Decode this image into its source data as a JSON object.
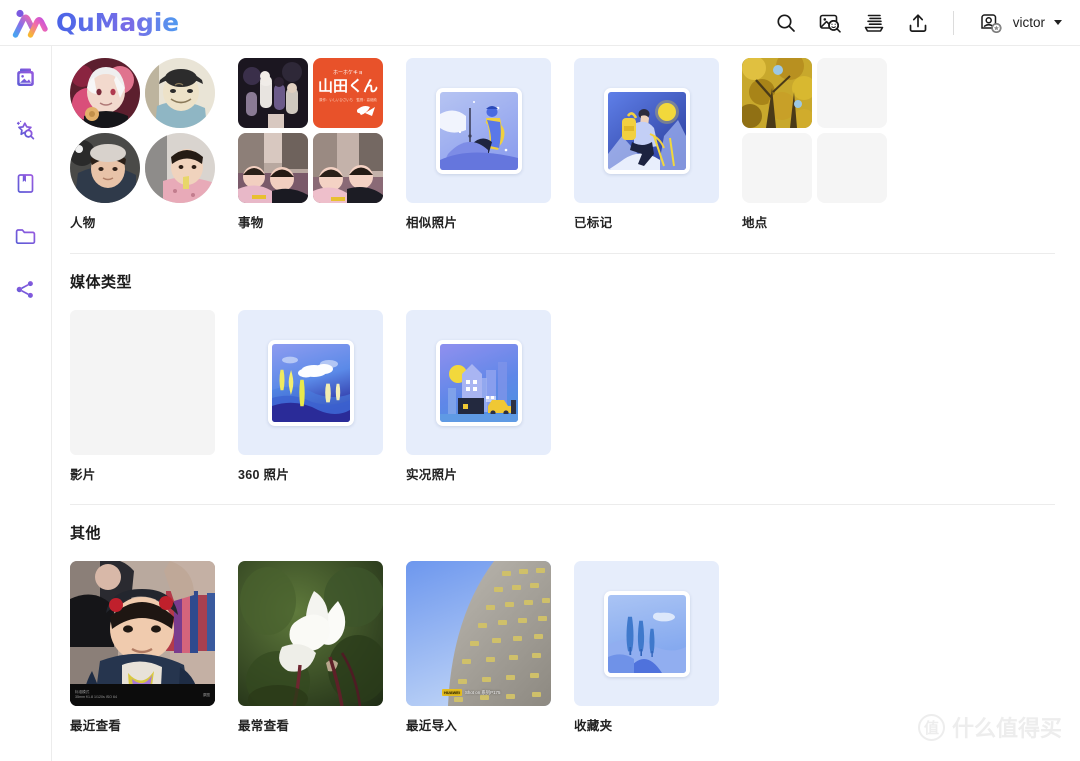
{
  "app": {
    "name": "QuMagie",
    "logo_icon": "qumagie-logo-icon"
  },
  "topbar": {
    "icons": [
      {
        "name": "search-icon",
        "label": "搜索"
      },
      {
        "name": "image-search-icon",
        "label": "以图搜图"
      },
      {
        "name": "slideshow-icon",
        "label": "幻灯片"
      },
      {
        "name": "upload-icon",
        "label": "上传"
      }
    ],
    "user": {
      "name": "victor",
      "avatar_icon": "user-avatar-icon",
      "badge_icon": "star-badge-icon",
      "caret_icon": "chevron-down-icon"
    }
  },
  "sidebar": {
    "items": [
      {
        "name": "sidebar-item-photos",
        "icon": "photos-icon",
        "active": true
      },
      {
        "name": "sidebar-item-explore",
        "icon": "magic-wand-search-icon",
        "active": false
      },
      {
        "name": "sidebar-item-albums",
        "icon": "album-book-icon",
        "active": false
      },
      {
        "name": "sidebar-item-folders",
        "icon": "folder-icon",
        "active": false
      },
      {
        "name": "sidebar-item-shared",
        "icon": "share-icon",
        "active": false
      }
    ]
  },
  "sections": [
    {
      "id": "top",
      "title": "",
      "tiles": [
        {
          "label": "人物",
          "kind": "circle-grid"
        },
        {
          "label": "事物",
          "kind": "square-grid"
        },
        {
          "label": "相似照片",
          "kind": "illustration-flag"
        },
        {
          "label": "已标记",
          "kind": "illustration-hiker"
        },
        {
          "label": "地点",
          "kind": "partial-grid"
        }
      ]
    },
    {
      "id": "media-type",
      "title": "媒体类型",
      "tiles": [
        {
          "label": "影片",
          "kind": "empty"
        },
        {
          "label": "360 照片",
          "kind": "illustration-landscape"
        },
        {
          "label": "实况照片",
          "kind": "illustration-city"
        }
      ]
    },
    {
      "id": "other",
      "title": "其他",
      "tiles": [
        {
          "label": "最近查看",
          "kind": "photo-kid"
        },
        {
          "label": "最常查看",
          "kind": "photo-flower"
        },
        {
          "label": "最近导入",
          "kind": "photo-building"
        },
        {
          "label": "收藏夹",
          "kind": "illustration-trees"
        }
      ]
    }
  ],
  "photo_overlays": {
    "exif_line1": "标准模式",
    "exif_line2": "35mm f/1.8 1/120s ISO 64",
    "exif_right": "原图",
    "shot_chip": "HUAWEI",
    "shot_text": "Shot on 系列P175"
  },
  "watermark": {
    "mark": "值",
    "text": "什么值得买"
  },
  "colors": {
    "brand_start": "#4a63e7",
    "brand_end": "#4f9af0",
    "tile_bg": "#e6edfb",
    "empty_tile": "#f4f4f4",
    "divider": "#ececec"
  }
}
